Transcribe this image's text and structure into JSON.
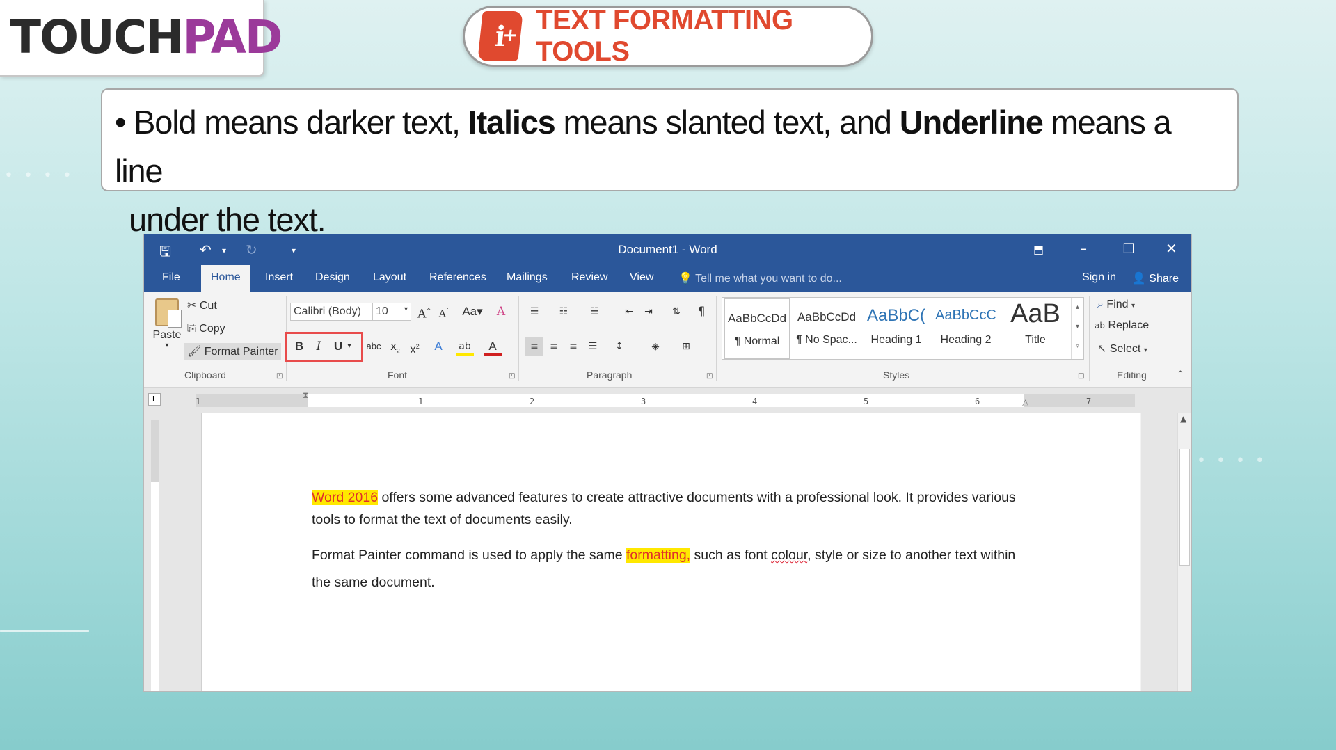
{
  "logo": {
    "part1": "TOUCH",
    "part2": "PAD"
  },
  "header": {
    "title": "TEXT FORMATTING TOOLS",
    "icon": "info-plus-icon"
  },
  "bullet": {
    "t1": "Bold means darker text,",
    "b1": "Italics",
    "t2": "means slanted text, and",
    "b2": "Underline",
    "t3": "means a line",
    "line2": "under the text."
  },
  "word": {
    "title": "Document1 - Word",
    "tabs": [
      "File",
      "Home",
      "Insert",
      "Design",
      "Layout",
      "References",
      "Mailings",
      "Review",
      "View"
    ],
    "tell_me": "Tell me what you want to do...",
    "sign_in": "Sign in",
    "share": "Share",
    "clipboard": {
      "paste": "Paste",
      "cut": "Cut",
      "copy": "Copy",
      "format_painter": "Format Painter",
      "label": "Clipboard"
    },
    "font": {
      "name": "Calibri (Body)",
      "size": "10",
      "label": "Font",
      "bold": "B",
      "italic": "I",
      "underline": "U",
      "strike": "abc",
      "change_case": "Aa"
    },
    "paragraph": {
      "label": "Paragraph"
    },
    "styles": {
      "label": "Styles",
      "items": [
        {
          "sample": "AaBbCcDd",
          "name": "¶ Normal"
        },
        {
          "sample": "AaBbCcDd",
          "name": "¶ No Spac..."
        },
        {
          "sample": "AaBbC(",
          "name": "Heading 1"
        },
        {
          "sample": "AaBbCcC",
          "name": "Heading 2"
        },
        {
          "sample": "AaB",
          "name": "Title"
        }
      ]
    },
    "editing": {
      "find": "Find",
      "replace": "Replace",
      "select": "Select",
      "label": "Editing"
    },
    "ruler": [
      "1",
      "1",
      "2",
      "3",
      "4",
      "5",
      "6",
      "7"
    ],
    "document": {
      "p1_highlight": "Word 2016",
      "p1_rest": " offers some advanced features to create attractive documents with a professional look. It provides various tools to format the text of documents easily.",
      "p2_a": "Format Painter command is used to apply the same ",
      "p2_highlight": "formatting,",
      "p2_b": " such as font ",
      "p2_squiggle": "colour",
      "p2_c": ", style or size to another text within the same document."
    }
  },
  "colors": {
    "word_blue": "#2b579a",
    "accent_red": "#e0492f",
    "logo_purple": "#9b3a9a",
    "highlight_yellow": "#ffe800"
  }
}
